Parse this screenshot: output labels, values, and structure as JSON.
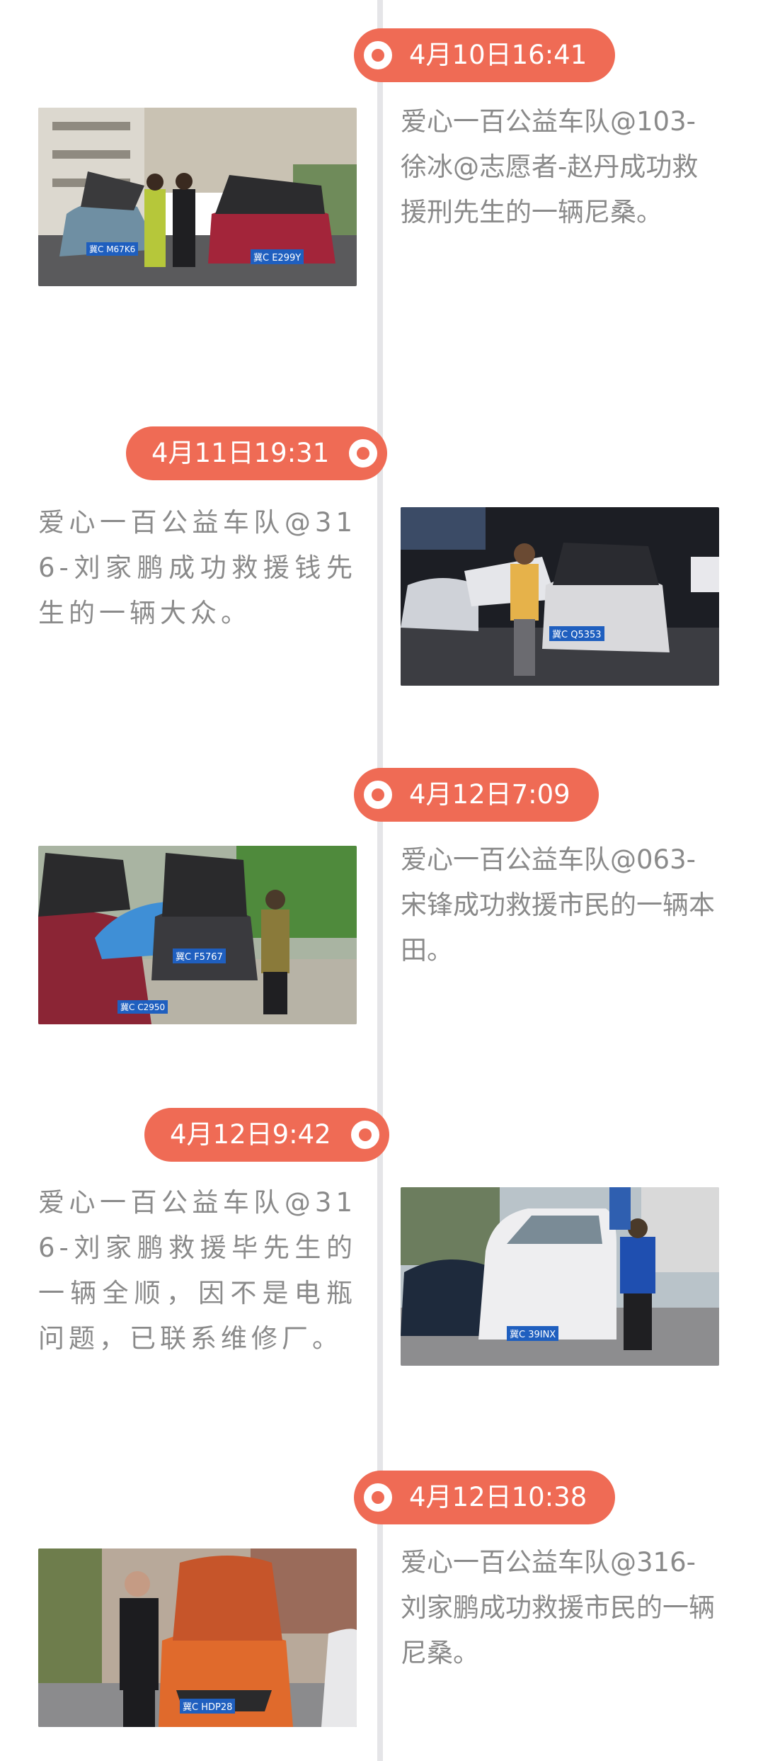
{
  "timeline": {
    "entries": [
      {
        "time": "4月10日16:41",
        "text": "爱心一百公益车队@103-徐冰@志愿者-赵丹成功救援刑先生的一辆尼桑。",
        "plate_main": "冀C E299Y",
        "plate_second": "冀C M67K6"
      },
      {
        "time": "4月11日19:31",
        "text": "爱心一百公益车队@316-刘家鹏成功救援钱先生的一辆大众。",
        "plate_main": "冀C Q5353"
      },
      {
        "time": "4月12日7:09",
        "text": "爱心一百公益车队@063-宋锋成功救援市民的一辆本田。",
        "plate_main": "冀C F5767",
        "plate_second": "冀C C2950"
      },
      {
        "time": "4月12日9:42",
        "text": "爱心一百公益车队@316-刘家鹏救援毕先生的一辆全顺，因不是电瓶问题，已联系维修厂。",
        "plate_main": "冀C 39INX"
      },
      {
        "time": "4月12日10:38",
        "text": "爱心一百公益车队@316-刘家鹏成功救援市民的一辆尼桑。",
        "plate_main": "冀C HDP28"
      }
    ]
  },
  "colors": {
    "accent": "#ef6b55",
    "timeline": "#e5e5e8",
    "text": "#8a8a8a"
  }
}
